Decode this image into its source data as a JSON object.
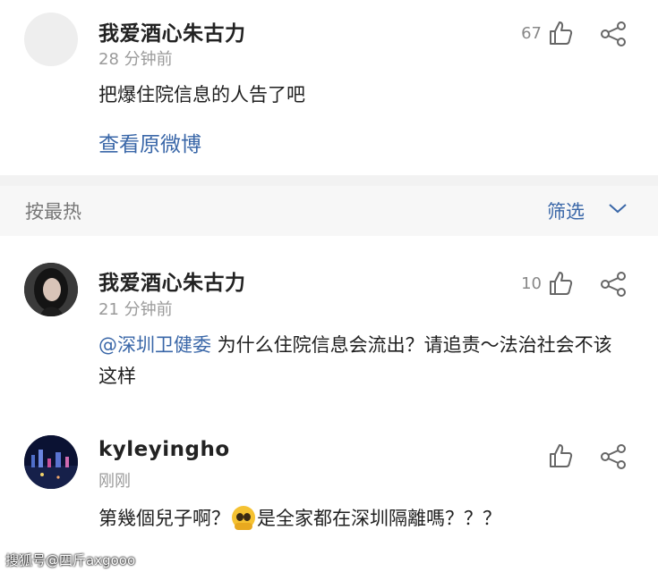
{
  "top_comment": {
    "username": "我爱酒心朱古力",
    "time": "28 分钟前",
    "like_count": "67",
    "text": "把爆住院信息的人告了吧",
    "view_original": "查看原微博"
  },
  "sort_bar": {
    "sort_label": "按最热",
    "filter_label": "筛选"
  },
  "comments": [
    {
      "username": "我爱酒心朱古力",
      "time": "21 分钟前",
      "like_count": "10",
      "mention": "@深圳卫健委",
      "text": " 为什么住院信息会流出？请追责～法治社会不该这样"
    },
    {
      "username": "kyleyingho",
      "time": "刚刚",
      "like_count": "",
      "text_before": "第幾個兒子啊？",
      "text_after": "是全家都在深圳隔離嗎？？？"
    }
  ],
  "watermark": "搜狐号@四斤axgooo",
  "colors": {
    "link": "#3a67a8",
    "muted": "#9a9a9a",
    "divider_bg": "#f2f2f2",
    "sortbar_bg": "#f7f7f7"
  },
  "icons": [
    "thumb-up-icon",
    "share-icon",
    "chevron-down-icon",
    "pleading-face-emoji"
  ]
}
